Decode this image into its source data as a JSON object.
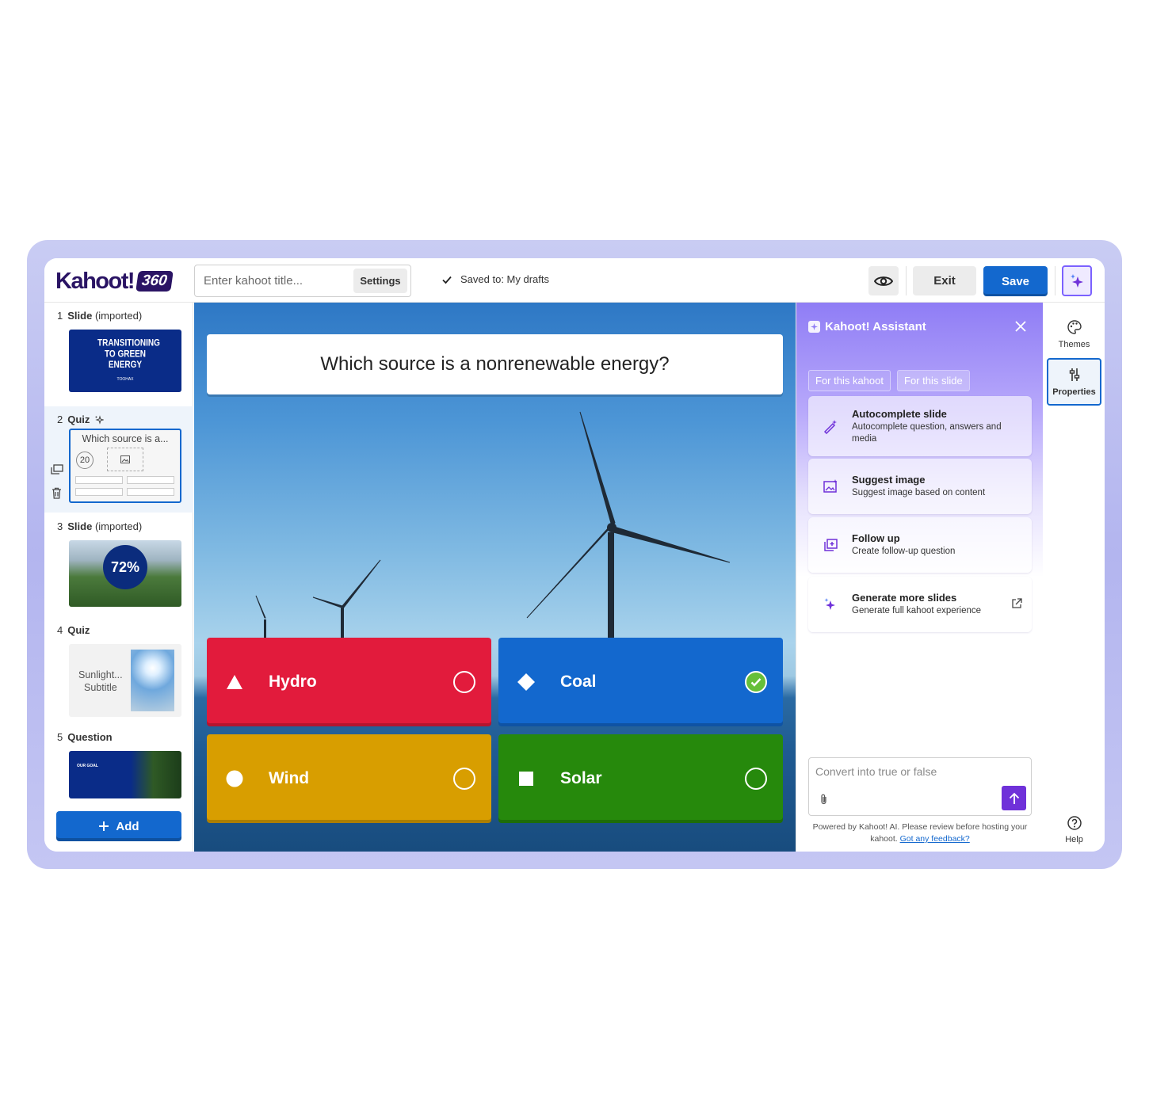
{
  "header": {
    "logo_text": "Kahoot!",
    "logo_badge": "360",
    "title_placeholder": "Enter kahoot title...",
    "settings_label": "Settings",
    "saved_status": "Saved to: My drafts",
    "exit_label": "Exit",
    "save_label": "Save"
  },
  "sidebar": {
    "items": [
      {
        "number": "1",
        "type": "Slide",
        "suffix": "(imported)",
        "thumb_title": "TRANSITIONING TO GREEN ENERGY",
        "thumb_brand": "TOOHAX"
      },
      {
        "number": "2",
        "type": "Quiz",
        "suffix": "",
        "thumb_title": "Which source is a...",
        "thumb_timer": "20"
      },
      {
        "number": "3",
        "type": "Slide",
        "suffix": "(imported)",
        "thumb_stat": "72%"
      },
      {
        "number": "4",
        "type": "Quiz",
        "suffix": "",
        "thumb_title": "Sunlight...",
        "thumb_subtitle": "Subtitle"
      },
      {
        "number": "5",
        "type": "Question",
        "suffix": "",
        "thumb_title": "OUR GOAL"
      }
    ],
    "add_label": "Add"
  },
  "canvas": {
    "question": "Which source is a nonrenewable energy?",
    "answers": [
      {
        "text": "Hydro",
        "color": "#e21b3c",
        "shape": "triangle",
        "correct": false
      },
      {
        "text": "Coal",
        "color": "#1368ce",
        "shape": "diamond",
        "correct": true
      },
      {
        "text": "Wind",
        "color": "#d89e00",
        "shape": "circle",
        "correct": false
      },
      {
        "text": "Solar",
        "color": "#26890c",
        "shape": "square",
        "correct": false
      }
    ]
  },
  "assistant": {
    "title": "Kahoot! Assistant",
    "tabs": [
      "For this kahoot",
      "For this slide"
    ],
    "cards": [
      {
        "title": "Autocomplete slide",
        "desc": "Autocomplete question, answers and media",
        "icon": "wand-icon"
      },
      {
        "title": "Suggest image",
        "desc": "Suggest image based on content",
        "icon": "image-sparkle-icon"
      },
      {
        "title": "Follow up",
        "desc": "Create follow-up question",
        "icon": "add-slide-icon"
      },
      {
        "title": "Generate more slides",
        "desc": "Generate full kahoot experience",
        "icon": "sparkle-icon"
      }
    ],
    "input_placeholder": "Convert into true or false",
    "footer_text": "Powered by Kahoot! AI. Please review before hosting your kahoot.",
    "footer_link": "Got any feedback?"
  },
  "rail": {
    "themes_label": "Themes",
    "properties_label": "Properties",
    "help_label": "Help"
  }
}
